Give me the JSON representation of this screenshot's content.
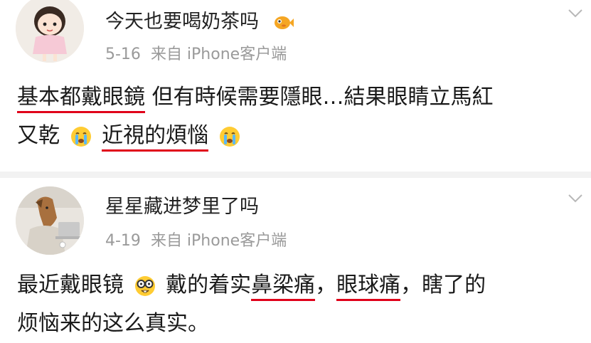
{
  "posts": [
    {
      "username": "今天也要喝奶茶吗",
      "date": "5-16",
      "source": "来自 iPhone客户端",
      "text": {
        "seg1": "基本都戴眼鏡",
        "seg2": " 但有時候需要隱眼…結果眼睛立馬紅",
        "seg3": "又乾",
        "seg4": "近視的煩惱"
      },
      "icons": [
        "fish-emoji-icon",
        "crying-emoji-icon",
        "crying-emoji-icon",
        "chevron-down-icon"
      ]
    },
    {
      "username": "星星藏进梦里了吗",
      "date": "4-19",
      "source": "来自 iPhone客户端",
      "text": {
        "seg1": "最近戴眼镜",
        "seg2": "戴的着实",
        "seg3": "鼻梁痛",
        "seg4": "，",
        "seg5": "眼球痛",
        "seg6": "，瞎了的",
        "seg7": "烦恼来的这么真实。"
      },
      "icons": [
        "nerd-glasses-emoji-icon",
        "chevron-down-icon"
      ]
    }
  ],
  "colors": {
    "underline": "#e0001a",
    "meta": "#9a9a9a",
    "text": "#1a1a1a"
  }
}
